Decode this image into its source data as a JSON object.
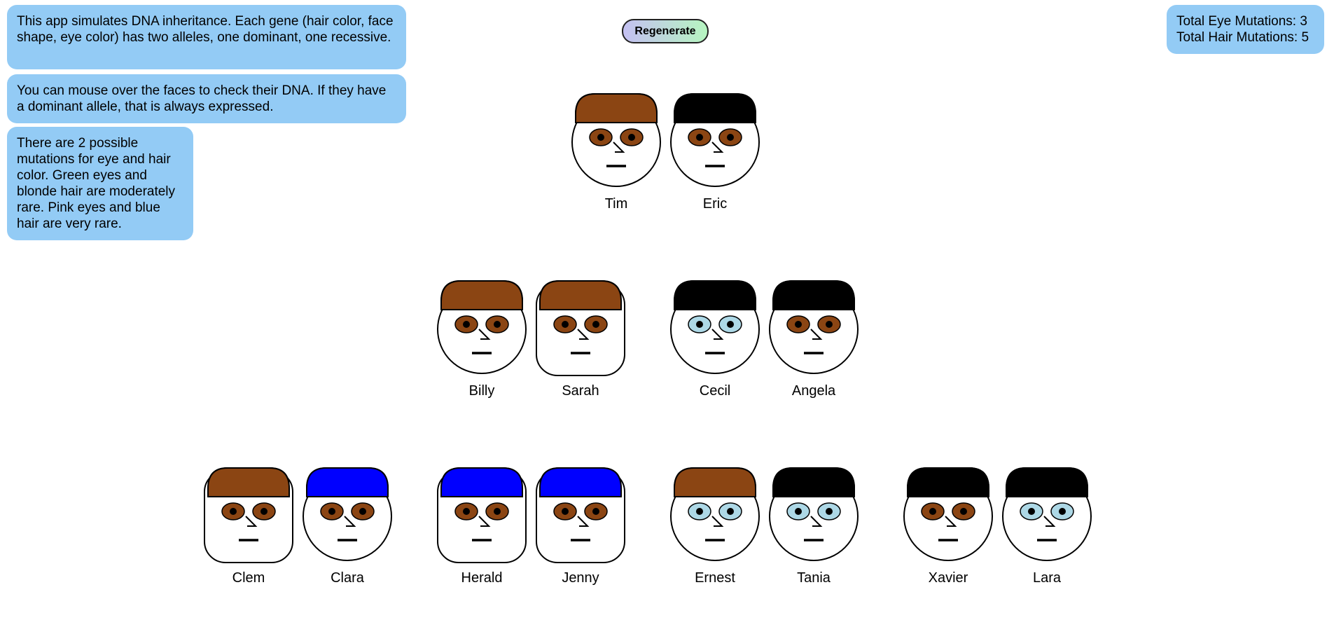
{
  "info": [
    "This app simulates DNA inheritance. Each gene (hair color, face shape, eye color) has two alleles, one dominant, one recessive.",
    "You can mouse over the faces to check their DNA. If they have a dominant allele, that is always expressed.",
    "There are 2 possible mutations for eye and hair color. Green eyes and blonde hair are moderately rare. Pink eyes and blue hair are very rare."
  ],
  "stats": {
    "eye_mutations": "Total Eye Mutations: 3",
    "hair_mutations": "Total Hair Mutations: 5"
  },
  "regenerate_label": "Regenerate",
  "colors": {
    "hair_brown": "#8b4513",
    "hair_black": "#000000",
    "hair_blue": "#0000ff",
    "eye_brown": "#8b4513",
    "eye_lightblue": "#add8e6",
    "info_box": "#93cbf5"
  },
  "people": [
    {
      "name": "Tim",
      "hair": "brown",
      "eyes": "brown",
      "face": "round"
    },
    {
      "name": "Eric",
      "hair": "black",
      "eyes": "brown",
      "face": "round"
    },
    {
      "name": "Billy",
      "hair": "brown",
      "eyes": "brown",
      "face": "round"
    },
    {
      "name": "Sarah",
      "hair": "brown",
      "eyes": "brown",
      "face": "square"
    },
    {
      "name": "Cecil",
      "hair": "black",
      "eyes": "lightblue",
      "face": "round"
    },
    {
      "name": "Angela",
      "hair": "black",
      "eyes": "brown",
      "face": "round"
    },
    {
      "name": "Clem",
      "hair": "brown",
      "eyes": "brown",
      "face": "square"
    },
    {
      "name": "Clara",
      "hair": "blue",
      "eyes": "brown",
      "face": "round"
    },
    {
      "name": "Herald",
      "hair": "blue",
      "eyes": "brown",
      "face": "square"
    },
    {
      "name": "Jenny",
      "hair": "blue",
      "eyes": "brown",
      "face": "square"
    },
    {
      "name": "Ernest",
      "hair": "brown",
      "eyes": "lightblue",
      "face": "round"
    },
    {
      "name": "Tania",
      "hair": "black",
      "eyes": "lightblue",
      "face": "round"
    },
    {
      "name": "Xavier",
      "hair": "black",
      "eyes": "brown",
      "face": "round"
    },
    {
      "name": "Lara",
      "hair": "black",
      "eyes": "lightblue",
      "face": "round"
    }
  ]
}
